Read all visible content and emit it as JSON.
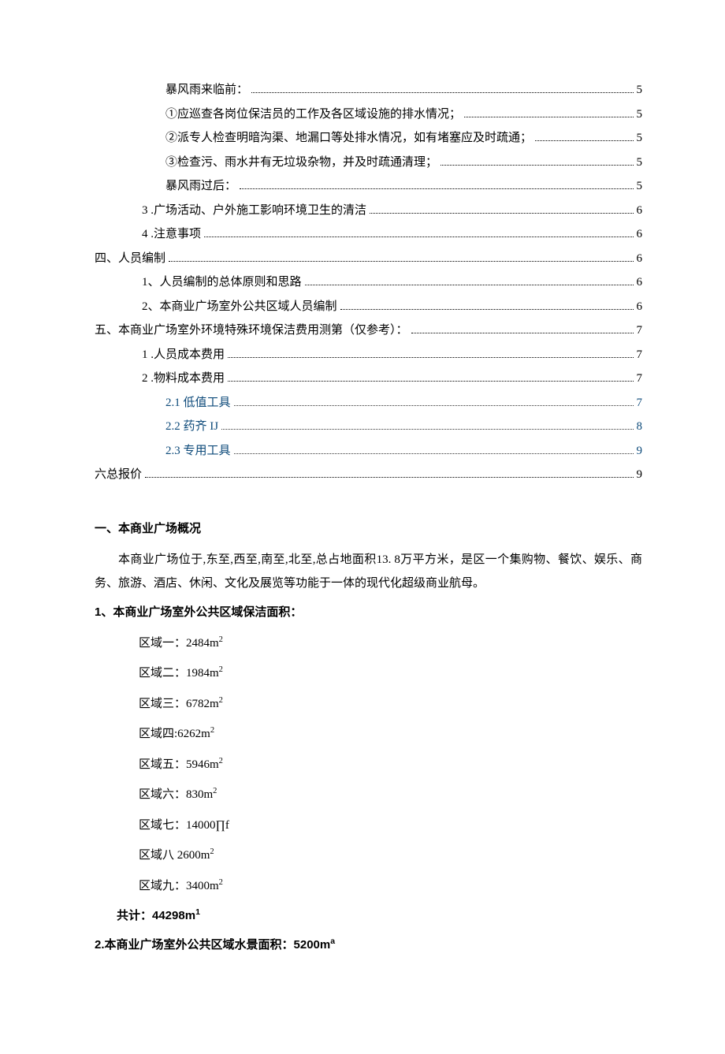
{
  "toc": [
    {
      "indent": 3,
      "label": "暴风雨来临前：",
      "page": "5",
      "blue": false
    },
    {
      "indent": 3,
      "label": "①应巡查各岗位保洁员的工作及各区域设施的排水情况；",
      "page": "5",
      "blue": false
    },
    {
      "indent": 3,
      "label": "②派专人检查明暗沟渠、地漏口等处排水情况，如有堵塞应及时疏通；",
      "page": "5",
      "blue": false
    },
    {
      "indent": 3,
      "label": "③检查污、雨水井有无垃圾杂物，并及时疏通清理；",
      "page": "5",
      "blue": false
    },
    {
      "indent": 3,
      "label": "暴风雨过后：",
      "page": "5",
      "blue": false
    },
    {
      "indent": 2,
      "label": "3  .广场活动、户外施工影响环境卫生的清洁",
      "page": "6",
      "blue": false
    },
    {
      "indent": 2,
      "label": "4  .注意事项",
      "page": "6",
      "blue": false
    },
    {
      "indent": 0,
      "label": "四、人员编制",
      "page": "6",
      "blue": false
    },
    {
      "indent": 2,
      "label": "1、人员编制的总体原则和思路",
      "page": "6",
      "blue": false
    },
    {
      "indent": 2,
      "label": "2、本商业广场室外公共区域人员编制",
      "page": "6",
      "blue": false
    },
    {
      "indent": 0,
      "label": "五、本商业广场室外环境特殊环境保洁费用测第（仅参考）：",
      "page": "7",
      "blue": false
    },
    {
      "indent": 2,
      "label": "1  .人员成本费用",
      "page": "7",
      "blue": false
    },
    {
      "indent": 2,
      "label": "2  .物料成本费用",
      "page": "7",
      "blue": false
    },
    {
      "indent": 3,
      "label": "2.1   低值工具",
      "page": "7",
      "blue": true,
      "fine": true
    },
    {
      "indent": 3,
      "label": "2.2   药齐 IJ",
      "page": "8",
      "blue": true,
      "fine": true
    },
    {
      "indent": 3,
      "label": "2.3   专用工具",
      "page": "9",
      "blue": true,
      "fine": true
    },
    {
      "indent": 0,
      "label": "六总报价",
      "page": "9",
      "blue": false
    }
  ],
  "h1": "一、本商业广场概况",
  "overview_para": "本商业广场位于,东至,西至,南至,北至,总占地面积13. 8万平方米，是区一个集购物、餐饮、娱乐、商务、旅游、酒店、休闲、文化及展览等功能于一体的现代化超级商业航母。",
  "sub1": "1、本商业广场室外公共区域保洁面积：",
  "areas": [
    {
      "text": "区域一：2484m",
      "sup": "2"
    },
    {
      "text": "区域二：1984m",
      "sup": "2"
    },
    {
      "text": "区域三：6782m",
      "sup": "2"
    },
    {
      "text": "区域四:6262m",
      "sup": "2"
    },
    {
      "text": "区域五：5946m",
      "sup": "2"
    },
    {
      "text": "区域六：830m",
      "sup": "2"
    },
    {
      "text": "区域七：14000∏f",
      "sup": ""
    },
    {
      "text": "区域八 2600m",
      "sup": "2"
    },
    {
      "text": "区域九：3400m",
      "sup": "2"
    }
  ],
  "total_line": "共计：44298m",
  "total_sup": "1",
  "sub2": "2.本商业广场室外公共区域水景面积：5200m",
  "sub2_sup": "a"
}
